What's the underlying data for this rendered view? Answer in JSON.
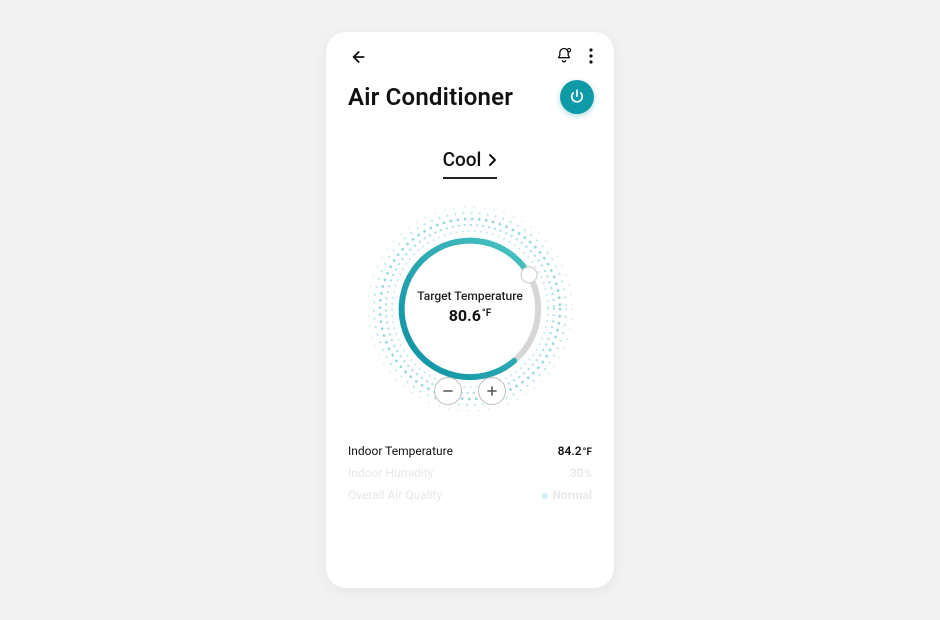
{
  "header": {
    "title": "Air Conditioner"
  },
  "icons": {
    "back": "back-arrow-icon",
    "bell": "bell-icon",
    "more": "more-vertical-icon",
    "power": "power-icon",
    "chevron": "chevron-right-icon",
    "minus": "minus-icon",
    "plus": "plus-icon"
  },
  "mode": {
    "label": "Cool"
  },
  "dial": {
    "target_label": "Target Temperature",
    "target_value": "80.6",
    "target_unit": "°F",
    "accent_start": "#0b8fa3",
    "accent_end": "#4cc4c2",
    "track": "#d5d5d5"
  },
  "controls": {
    "decrease": "−",
    "increase": "+"
  },
  "stats": [
    {
      "label": "Indoor Temperature",
      "value": "84.2",
      "unit": "°F",
      "faded": false
    },
    {
      "label": "Indoor Humidity",
      "value": "30",
      "unit": "%",
      "faded": true
    },
    {
      "label": "Overall Air Quality",
      "value": "Normal",
      "unit": "",
      "faded": true,
      "status": true
    }
  ]
}
